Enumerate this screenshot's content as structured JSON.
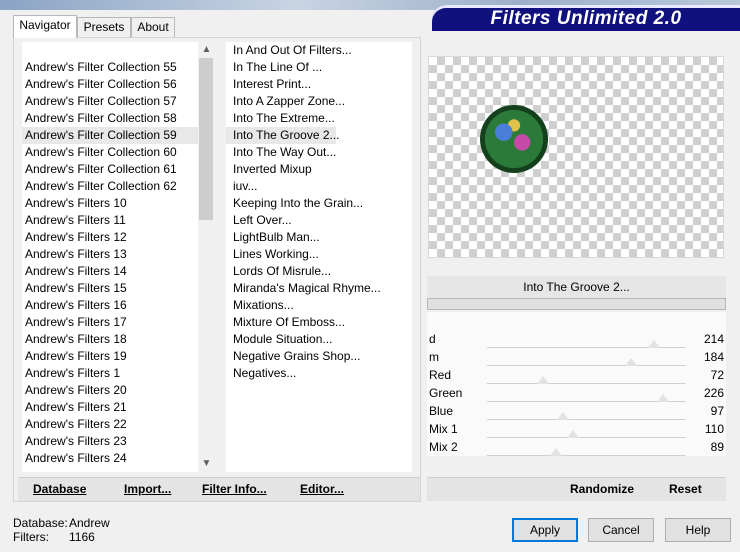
{
  "header": {
    "title": "Filters Unlimited 2.0"
  },
  "tabs": [
    {
      "label": "Navigator"
    },
    {
      "label": "Presets"
    },
    {
      "label": "About"
    }
  ],
  "categories": {
    "selected_index": 4,
    "items": [
      "Andrew's Filter Collection 55",
      "Andrew's Filter Collection 56",
      "Andrew's Filter Collection 57",
      "Andrew's Filter Collection 58",
      "Andrew's Filter Collection 59",
      "Andrew's Filter Collection 60",
      "Andrew's Filter Collection 61",
      "Andrew's Filter Collection 62",
      "Andrew's Filters 10",
      "Andrew's Filters 11",
      "Andrew's Filters 12",
      "Andrew's Filters 13",
      "Andrew's Filters 14",
      "Andrew's Filters 15",
      "Andrew's Filters 16",
      "Andrew's Filters 17",
      "Andrew's Filters 18",
      "Andrew's Filters 19",
      "Andrew's Filters 1",
      "Andrew's Filters 20",
      "Andrew's Filters 21",
      "Andrew's Filters 22",
      "Andrew's Filters 23",
      "Andrew's Filters 24"
    ]
  },
  "filters": {
    "selected_index": 5,
    "items": [
      "In And Out Of Filters...",
      "In The Line Of ...",
      "Interest Print...",
      "Into A Zapper Zone...",
      "Into The Extreme...",
      "Into The Groove 2...",
      "Into The Way Out...",
      "Inverted Mixup",
      "iuv...",
      "Keeping Into the Grain...",
      "Left Over...",
      "LightBulb Man...",
      "Lines Working...",
      "Lords Of Misrule...",
      "Miranda's Magical Rhyme...",
      "Mixations...",
      "Mixture Of Emboss...",
      "Module Situation...",
      "Negative Grains Shop...",
      "Negatives..."
    ]
  },
  "left_buttons": {
    "database": "Database",
    "import": "Import...",
    "filter_info": "Filter Info...",
    "editor": "Editor..."
  },
  "current_filter": "Into The Groove 2...",
  "parameters": [
    {
      "name": "d",
      "value": 214
    },
    {
      "name": "m",
      "value": 184
    },
    {
      "name": "Red",
      "value": 72
    },
    {
      "name": "Green",
      "value": 226
    },
    {
      "name": "Blue",
      "value": 97
    },
    {
      "name": "Mix 1",
      "value": 110
    },
    {
      "name": "Mix 2",
      "value": 89
    }
  ],
  "right_buttons": {
    "randomize": "Randomize",
    "reset": "Reset"
  },
  "status": {
    "database_label": "Database:",
    "database_value": "Andrew",
    "filters_label": "Filters:",
    "filters_value": "1166"
  },
  "dialog_buttons": {
    "apply": "Apply",
    "cancel": "Cancel",
    "help": "Help"
  }
}
